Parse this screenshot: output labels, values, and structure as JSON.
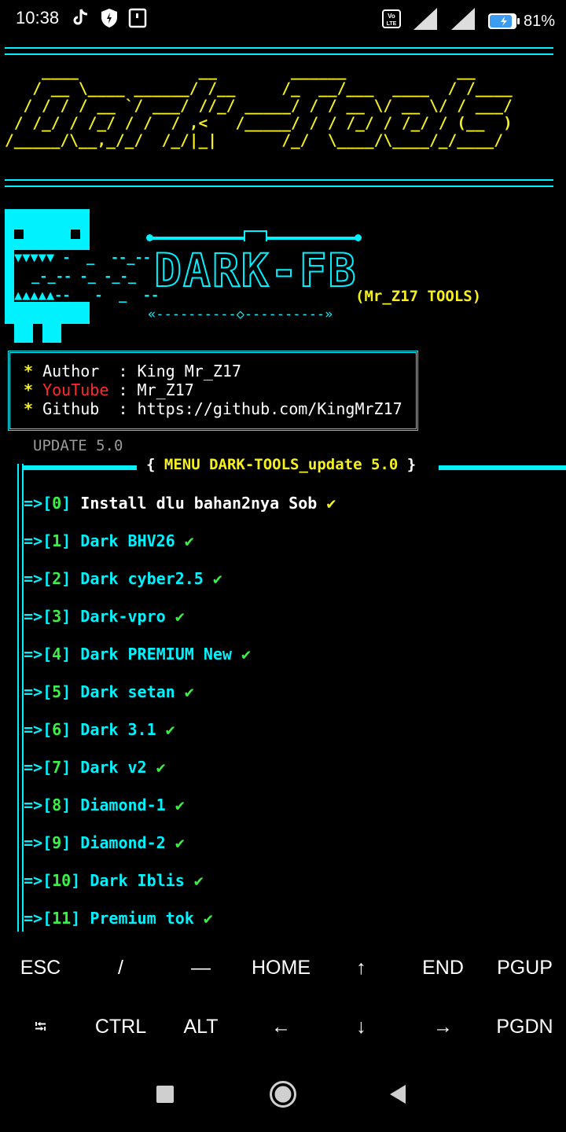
{
  "status_bar": {
    "time": "10:38",
    "battery": "81%",
    "volte": "Vo LTE",
    "icons": [
      "tiktok-icon",
      "shield-icon",
      "screenshot-icon",
      "volte-icon",
      "signal-icon",
      "signal-icon",
      "battery-icon"
    ]
  },
  "banner": {
    "ascii_lines": [
      "    ____             __        ______            __",
      "   / __ \\____ ______/ /__     /_  __/___  ____  / /____",
      "  / / / / __ `/ ___/ //_/ _____/ / / __ \\/ __ \\/ / ___/",
      " / /_/ / /_/ / /  / ,<   /_____/ / / /_/ / /_/ / (__  )",
      "/_____/\\__,_/_/  /_/|_|       /_/  \\____/\\____/_/____/"
    ]
  },
  "logo": {
    "title": "DARK-FB",
    "subtitle": "(Mr_Z17 TOOLS)",
    "underline": "«----------◇----------»",
    "teeth_top": "▼▼▼▼▼ -  _  --_--",
    "teeth_mid": "_-_-- -_ -_-_",
    "teeth_bot": "▲▲▲▲▲--   -  _  --"
  },
  "info": {
    "author_label": "Author",
    "author_value": "King Mr_Z17",
    "youtube_label": "YouTube",
    "youtube_value": "Mr_Z17",
    "github_label": "Github",
    "github_value": "https://github.com/KingMrZ17",
    "bullet": "*",
    "sep": ":"
  },
  "update_label": "UPDATE 5.0",
  "menu": {
    "open": "{ ",
    "title": "MENU DARK-TOOLS_update 5.0",
    "close": " }",
    "arrow": "=>",
    "check": "✔",
    "items": [
      {
        "num": "0",
        "label": "Install dlu bahan2nya Sob"
      },
      {
        "num": "1",
        "label": "Dark BHV26"
      },
      {
        "num": "2",
        "label": "Dark cyber2.5"
      },
      {
        "num": "3",
        "label": "Dark-vpro"
      },
      {
        "num": "4",
        "label": "Dark PREMIUM New"
      },
      {
        "num": "5",
        "label": "Dark setan"
      },
      {
        "num": "6",
        "label": "Dark 3.1"
      },
      {
        "num": "7",
        "label": "Dark v2"
      },
      {
        "num": "8",
        "label": "Diamond-1"
      },
      {
        "num": "9",
        "label": "Diamond-2"
      },
      {
        "num": "10",
        "label": "Dark Iblis"
      },
      {
        "num": "11",
        "label": "Premium tok"
      }
    ]
  },
  "extra_keys": {
    "row1": [
      "ESC",
      "/",
      "—",
      "HOME",
      "↑",
      "END",
      "PGUP"
    ],
    "row2": [
      "⭾",
      "CTRL",
      "ALT",
      "←",
      "↓",
      "→",
      "PGDN"
    ]
  },
  "colors": {
    "cyan": "#00f2ff",
    "yellow": "#f5f01e",
    "green": "#3cf04a",
    "red": "#ff2b2b",
    "grey": "#9a9a9a"
  }
}
